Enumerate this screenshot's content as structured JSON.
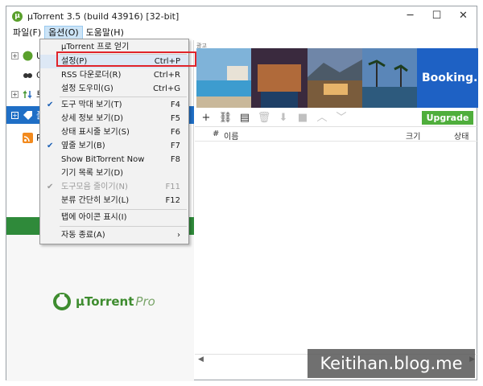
{
  "window": {
    "title": "µTorrent 3.5  (build 43916) [32-bit]",
    "controls": [
      "─",
      "☐",
      "✕"
    ]
  },
  "menubar": {
    "file": "파일(F)",
    "options": "옵션(O)",
    "help": "도움말(H)"
  },
  "sidebar": {
    "rows": [
      "U",
      "G",
      "토",
      "폴",
      "R"
    ],
    "pro_brand": "µTorrent",
    "pro_suffix": "Pro"
  },
  "ad": {
    "label": "광고",
    "booking": "Booking.c"
  },
  "toolbar": {
    "upgrade": "Upgrade"
  },
  "list": {
    "col_num": "#",
    "col_name": "이름",
    "col_size": "크기",
    "col_status": "상태"
  },
  "dropdown": {
    "items": [
      {
        "label": "µTorrent 프로 얻기",
        "shortcut": ""
      },
      {
        "label": "설정(P)",
        "shortcut": "Ctrl+P"
      },
      {
        "label": "RSS 다운로더(R)",
        "shortcut": "Ctrl+R"
      },
      {
        "label": "설정 도우미(G)",
        "shortcut": "Ctrl+G"
      },
      {
        "label": "도구 막대 보기(T)",
        "shortcut": "F4"
      },
      {
        "label": "상세 정보 보기(D)",
        "shortcut": "F5"
      },
      {
        "label": "상태 표시줄 보기(S)",
        "shortcut": "F6"
      },
      {
        "label": "옆줄 보기(B)",
        "shortcut": "F7"
      },
      {
        "label": "Show BitTorrent Now",
        "shortcut": "F8"
      },
      {
        "label": "기기 목록 보기(D)",
        "shortcut": ""
      },
      {
        "label": "도구모음 줄이기(N)",
        "shortcut": "F11"
      },
      {
        "label": "분류 간단히 보기(L)",
        "shortcut": "F12"
      },
      {
        "label": "탭에 아이콘 표시(I)",
        "shortcut": ""
      },
      {
        "label": "자동 종료(A)",
        "shortcut": "›"
      }
    ],
    "checkmark": "✔"
  },
  "watermark": "Keitihan.blog.me"
}
